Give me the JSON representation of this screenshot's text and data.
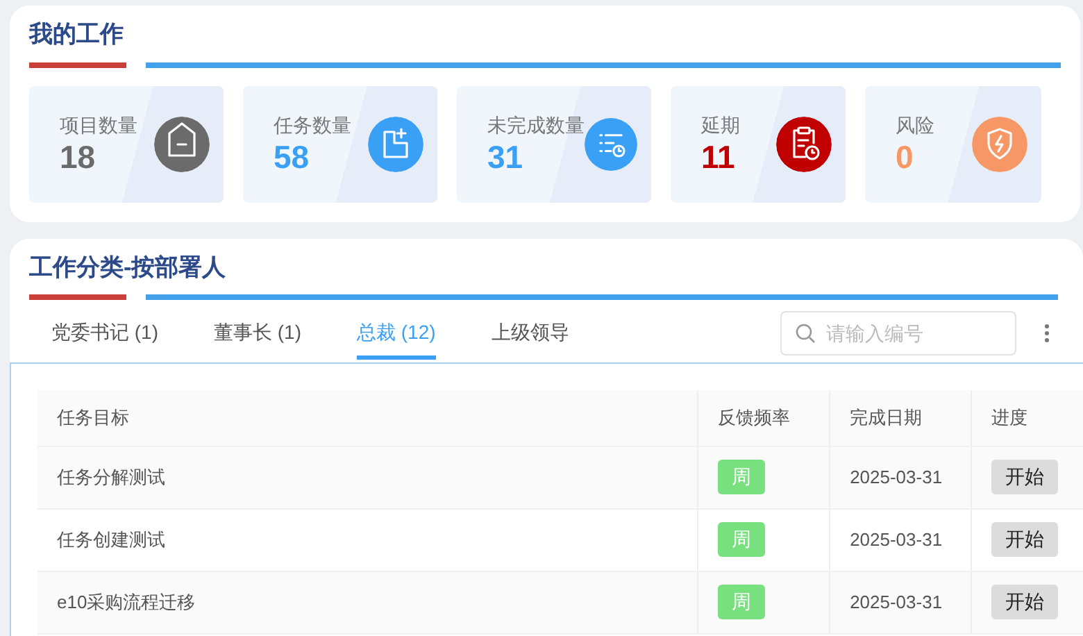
{
  "overview": {
    "title": "我的工作",
    "stats": [
      {
        "label": "项目数量",
        "value": "18",
        "color": "#6b6b6b",
        "kind": "project"
      },
      {
        "label": "任务数量",
        "value": "58",
        "color": "#3aa0f5",
        "kind": "task"
      },
      {
        "label": "未完成数量",
        "value": "31",
        "color": "#3aa0f5",
        "kind": "unfinished"
      },
      {
        "label": "延期",
        "value": "11",
        "color": "#c00000",
        "kind": "delay"
      },
      {
        "label": "风险",
        "value": "0",
        "color": "#f79765",
        "kind": "risk"
      }
    ]
  },
  "assignment": {
    "title": "工作分类-按部署人",
    "tabs": [
      {
        "label": "党委书记 (1)",
        "selected": false
      },
      {
        "label": "董事长 (1)",
        "selected": false
      },
      {
        "label": "总裁 (12)",
        "selected": true
      },
      {
        "label": "上级领导",
        "selected": false
      }
    ],
    "search": {
      "placeholder": "请输入编号"
    },
    "table": {
      "columns": [
        "任务目标",
        "反馈频率",
        "完成日期",
        "进度"
      ],
      "rows": [
        {
          "goal": "任务分解测试",
          "frequency": "周",
          "date": "2025-03-31",
          "progress": "开始"
        },
        {
          "goal": "任务创建测试",
          "frequency": "周",
          "date": "2025-03-31",
          "progress": "开始"
        },
        {
          "goal": "e10采购流程迁移",
          "frequency": "周",
          "date": "2025-03-31",
          "progress": "开始"
        }
      ]
    }
  }
}
